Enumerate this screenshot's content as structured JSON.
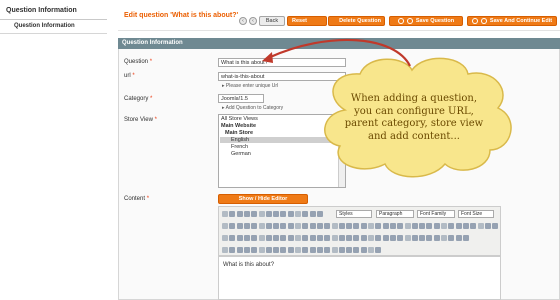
{
  "sidebar": {
    "title": "Question Information",
    "tab": "Question Information"
  },
  "header": {
    "title": "Edit question 'What is this about?'",
    "back_label": "Back",
    "reset_label": "Reset",
    "delete_label": "Delete Question",
    "save_label": "Save Question",
    "save_continue_label": "Save And Continue Edit"
  },
  "panel": {
    "heading": "Question Information",
    "question_label": "Question",
    "question_value": "What is this about?",
    "url_label": "url",
    "url_value": "what-is-this-about",
    "url_note": "Please enter unique Url",
    "category_label": "Category",
    "category_value": "Joomla!1.5",
    "category_link": "Add Question to Category",
    "store_label": "Store View",
    "store_options": [
      "All Store Views",
      "Main Website",
      "Main Store",
      "English",
      "French",
      "German"
    ],
    "content_label": "Content",
    "editor_toggle": "Show / Hide Editor",
    "editor_styles": "Styles",
    "editor_format": "Paragraph",
    "editor_font_family": "Font Family",
    "editor_font_size": "Font Size",
    "editor_content": "What is this about?"
  },
  "callout": {
    "lines": [
      "When adding a question,",
      "you can configure URL,",
      "parent category, store view",
      "and add content..."
    ]
  },
  "colors": {
    "accent": "#ef7a16",
    "title": "#eb5e00",
    "panel_header": "#6f8992",
    "callout": "#f8e68c",
    "arrow": "#c0392b"
  }
}
